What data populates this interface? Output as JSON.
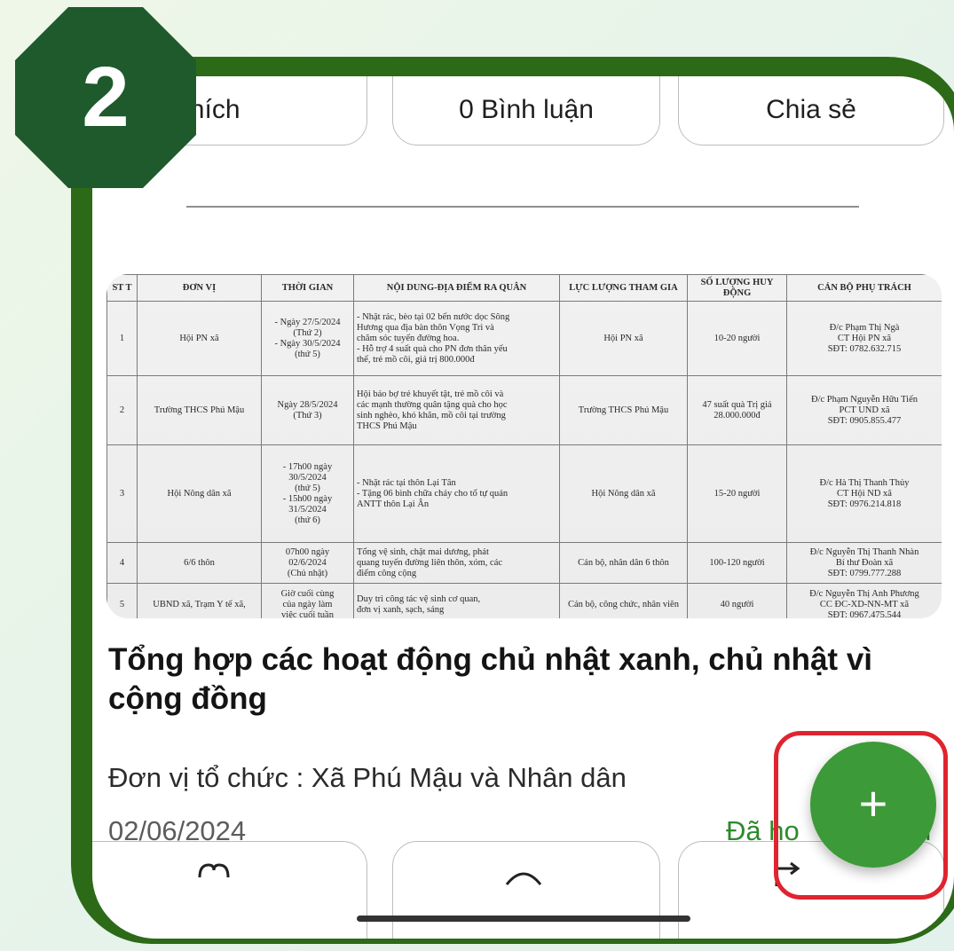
{
  "actions_top": {
    "like_label": "0 Thích",
    "comment_label": "0 Bình luận",
    "share_label": "Chia sẻ"
  },
  "step_badge": "2",
  "document": {
    "headers": [
      "ST T",
      "ĐƠN VỊ",
      "THỜI GIAN",
      "NỘI DUNG-ĐỊA ĐIỂM RA QUÂN",
      "LỰC LƯỢNG THAM GIA",
      "SỐ LƯỢNG HUY ĐỘNG",
      "CÁN BỘ PHỤ TRÁCH"
    ],
    "rows": [
      {
        "stt": "1",
        "unit": "Hội PN xã",
        "time": [
          "- Ngày 27/5/2024",
          "(Thứ 2)",
          "- Ngày 30/5/2024",
          "(thứ 5)"
        ],
        "content": [
          "- Nhặt rác, bèo tại 02 bến nước dọc Sông",
          "Hương qua địa bàn thôn Vọng Trì và",
          "chăm sóc tuyến đường hoa.",
          "- Hỗ trợ 4 suất quà cho PN đơn thân yếu",
          "thế, trẻ mồ côi, giá trị 800.000đ"
        ],
        "force": "Hội PN xã",
        "qty": "10-20 người",
        "lead": [
          "Đ/c Phạm Thị Ngà",
          "CT Hội PN xã",
          "SĐT: 0782.632.715"
        ]
      },
      {
        "stt": "2",
        "unit": "Trường THCS Phú Mậu",
        "time": [
          "Ngày 28/5/2024",
          "(Thứ 3)"
        ],
        "content": [
          "Hội báo bợ trẻ khuyết tật, trẻ mồ côi và",
          "các mạnh thường quân tặng quà cho học",
          "sinh nghèo, khó khăn, mồ côi tại trường",
          "THCS Phú Mậu"
        ],
        "force": "Trường THCS Phú Mậu",
        "qty": "47 suất quà Trị giá 28.000.000đ",
        "lead": [
          "Đ/c Phạm Nguyễn Hữu Tiến",
          "PCT UND xã",
          "SĐT: 0905.855.477"
        ]
      },
      {
        "stt": "3",
        "unit": "Hội Nông dân xã",
        "time": [
          "- 17h00 ngày",
          "30/5/2024",
          "(thứ 5)",
          "- 15h00 ngày",
          "31/5/2024",
          "(thứ 6)"
        ],
        "content": [
          "- Nhặt rác tại thôn Lại Tân",
          "- Tặng 06 bình chữa cháy cho tổ tự quản",
          "ANTT thôn Lại Ân"
        ],
        "force": "Hội Nông dân xã",
        "qty": "15-20 người",
        "lead": [
          "Đ/c Hà Thị Thanh Thủy",
          "CT Hội ND xã",
          "SĐT: 0976.214.818"
        ]
      },
      {
        "stt": "4",
        "unit": "6/6 thôn",
        "time": [
          "07h00 ngày",
          "02/6/2024",
          "(Chủ nhật)"
        ],
        "content": [
          "Tổng vệ sinh, chặt mai dương, phát",
          "quang tuyến đường liên thôn, xóm, các",
          "điểm công cộng"
        ],
        "force": "Cán bộ, nhân dân 6 thôn",
        "qty": "100-120 người",
        "lead": [
          "Đ/c Nguyễn Thị Thanh Nhàn",
          "Bí thư Đoàn xã",
          "SĐT: 0799.777.288"
        ]
      },
      {
        "stt": "5",
        "unit": "UBND xã, Trạm Y tế xã,",
        "time": [
          "Giờ cuối cùng",
          "của ngày làm",
          "việc cuối tuần"
        ],
        "content": [
          "Duy trì công tác vệ sinh cơ quan,",
          "đơn vị xanh, sạch, sáng"
        ],
        "force": "Cán bộ, công chức, nhân viên",
        "qty": "40 người",
        "lead": [
          "Đ/c Nguyễn Thị Anh Phương",
          "CC ĐC-XD-NN-MT xã",
          "SĐT: 0967.475.544"
        ]
      }
    ]
  },
  "post": {
    "title": "Tổng hợp các hoạt động chủ nhật xanh, chủ nhật vì cộng đồng",
    "organizer": "Đơn vị tổ chức : Xã Phú Mậu và Nhân dân",
    "date": "02/06/2024",
    "status": "Đã ho",
    "status_tail": "n"
  },
  "fab": {
    "label": "+"
  },
  "colors": {
    "frame_green": "#2c6a18",
    "badge_green": "#1e5a2c",
    "fab_green": "#3c9a38",
    "highlight_red": "#e0242f",
    "status_green": "#2c8a2c"
  },
  "icons": [
    "heart-icon",
    "comment-icon",
    "share-icon",
    "plus-icon"
  ]
}
